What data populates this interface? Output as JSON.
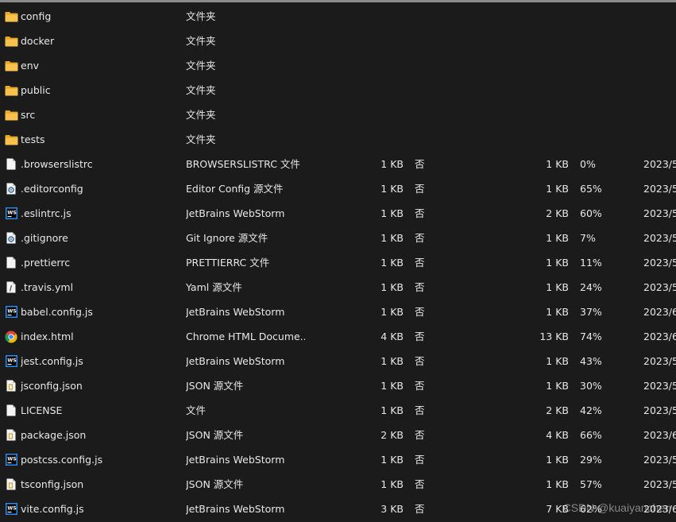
{
  "rows": [
    {
      "icon": "folder-icon",
      "name": "config",
      "type": "文件夹",
      "size": "",
      "encrypted": "",
      "compressed": "",
      "ratio": "",
      "date": ""
    },
    {
      "icon": "folder-icon",
      "name": "docker",
      "type": "文件夹",
      "size": "",
      "encrypted": "",
      "compressed": "",
      "ratio": "",
      "date": ""
    },
    {
      "icon": "folder-icon",
      "name": "env",
      "type": "文件夹",
      "size": "",
      "encrypted": "",
      "compressed": "",
      "ratio": "",
      "date": ""
    },
    {
      "icon": "folder-icon",
      "name": "public",
      "type": "文件夹",
      "size": "",
      "encrypted": "",
      "compressed": "",
      "ratio": "",
      "date": ""
    },
    {
      "icon": "folder-icon",
      "name": "src",
      "type": "文件夹",
      "size": "",
      "encrypted": "",
      "compressed": "",
      "ratio": "",
      "date": ""
    },
    {
      "icon": "folder-icon",
      "name": "tests",
      "type": "文件夹",
      "size": "",
      "encrypted": "",
      "compressed": "",
      "ratio": "",
      "date": ""
    },
    {
      "icon": "file-icon",
      "name": ".browserslistrc",
      "type": "BROWSERSLISTRC 文件",
      "size": "1 KB",
      "encrypted": "否",
      "compressed": "1 KB",
      "ratio": "0%",
      "date": "2023/5/"
    },
    {
      "icon": "config-file-icon",
      "name": ".editorconfig",
      "type": "Editor Config 源文件",
      "size": "1 KB",
      "encrypted": "否",
      "compressed": "1 KB",
      "ratio": "65%",
      "date": "2023/5/"
    },
    {
      "icon": "webstorm-icon",
      "name": ".eslintrc.js",
      "type": "JetBrains WebStorm",
      "size": "1 KB",
      "encrypted": "否",
      "compressed": "2 KB",
      "ratio": "60%",
      "date": "2023/5/"
    },
    {
      "icon": "config-file-icon",
      "name": ".gitignore",
      "type": "Git Ignore 源文件",
      "size": "1 KB",
      "encrypted": "否",
      "compressed": "1 KB",
      "ratio": "7%",
      "date": "2023/5/"
    },
    {
      "icon": "file-icon",
      "name": ".prettierrc",
      "type": "PRETTIERRC 文件",
      "size": "1 KB",
      "encrypted": "否",
      "compressed": "1 KB",
      "ratio": "11%",
      "date": "2023/5/"
    },
    {
      "icon": "code-file-icon",
      "name": ".travis.yml",
      "type": "Yaml 源文件",
      "size": "1 KB",
      "encrypted": "否",
      "compressed": "1 KB",
      "ratio": "24%",
      "date": "2023/5/"
    },
    {
      "icon": "webstorm-icon",
      "name": "babel.config.js",
      "type": "JetBrains WebStorm",
      "size": "1 KB",
      "encrypted": "否",
      "compressed": "1 KB",
      "ratio": "37%",
      "date": "2023/6/"
    },
    {
      "icon": "chrome-icon",
      "name": "index.html",
      "type": "Chrome HTML Docume...",
      "size": "4 KB",
      "encrypted": "否",
      "compressed": "13 KB",
      "ratio": "74%",
      "date": "2023/6/"
    },
    {
      "icon": "webstorm-icon",
      "name": "jest.config.js",
      "type": "JetBrains WebStorm",
      "size": "1 KB",
      "encrypted": "否",
      "compressed": "1 KB",
      "ratio": "43%",
      "date": "2023/5/"
    },
    {
      "icon": "json-file-icon",
      "name": "jsconfig.json",
      "type": "JSON 源文件",
      "size": "1 KB",
      "encrypted": "否",
      "compressed": "1 KB",
      "ratio": "30%",
      "date": "2023/5/"
    },
    {
      "icon": "file-icon",
      "name": "LICENSE",
      "type": "文件",
      "size": "1 KB",
      "encrypted": "否",
      "compressed": "2 KB",
      "ratio": "42%",
      "date": "2023/5/"
    },
    {
      "icon": "json-file-icon",
      "name": "package.json",
      "type": "JSON 源文件",
      "size": "2 KB",
      "encrypted": "否",
      "compressed": "4 KB",
      "ratio": "66%",
      "date": "2023/6/"
    },
    {
      "icon": "webstorm-icon",
      "name": "postcss.config.js",
      "type": "JetBrains WebStorm",
      "size": "1 KB",
      "encrypted": "否",
      "compressed": "1 KB",
      "ratio": "29%",
      "date": "2023/5/"
    },
    {
      "icon": "json-file-icon",
      "name": "tsconfig.json",
      "type": "JSON 源文件",
      "size": "1 KB",
      "encrypted": "否",
      "compressed": "1 KB",
      "ratio": "57%",
      "date": "2023/5/"
    },
    {
      "icon": "webstorm-icon",
      "name": "vite.config.js",
      "type": "JetBrains WebStorm",
      "size": "3 KB",
      "encrypted": "否",
      "compressed": "7 KB",
      "ratio": "62%",
      "date": "2023/6/"
    }
  ],
  "watermark": "CSDN @kuaiyanchen",
  "colors": {
    "background": "#1b1b1b",
    "text": "#e8e8e8",
    "folder": "#f2b53c",
    "webstorm": "#2d8cf0"
  }
}
